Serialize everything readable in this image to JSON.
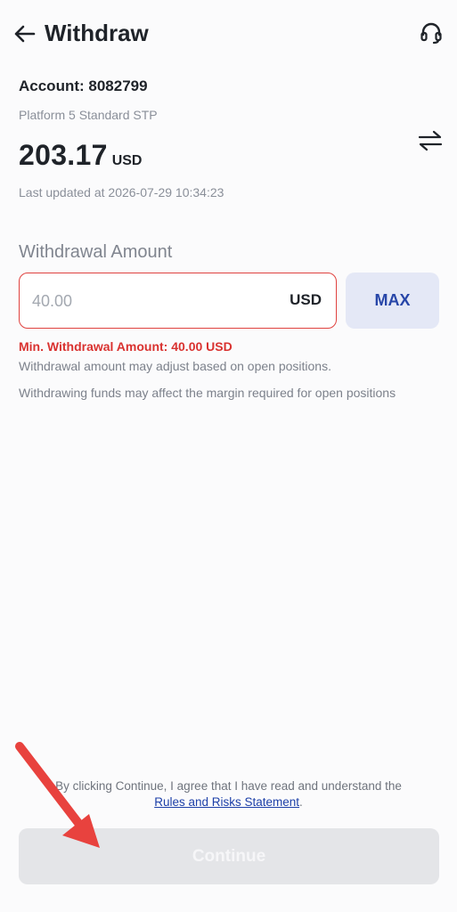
{
  "header": {
    "title": "Withdraw",
    "back_icon": "arrow-left-icon",
    "support_icon": "headset-icon"
  },
  "account": {
    "label": "Account: 8082799",
    "platform": "Platform 5 Standard STP",
    "balance": "203.17",
    "currency": "USD",
    "switch_icon": "swap-arrows-icon",
    "last_updated": "Last updated at 2026-07-29 10:34:23"
  },
  "withdrawal": {
    "section_label": "Withdrawal Amount",
    "input_value": "",
    "input_placeholder": "40.00",
    "input_currency": "USD",
    "max_label": "MAX",
    "error_text": "Min. Withdrawal Amount: 40.00 USD",
    "note_1": "Withdrawal amount may adjust based on open positions.",
    "note_2": "Withdrawing funds may affect the margin required for open positions"
  },
  "footer": {
    "consent_text": "By clicking Continue, I agree that I have read and understand the",
    "consent_link": "Rules and Risks Statement",
    "consent_end": ".",
    "continue_label": "Continue"
  },
  "colors": {
    "error": "#d93230",
    "accent": "#2746a8",
    "annotation_arrow": "#e8423e"
  }
}
